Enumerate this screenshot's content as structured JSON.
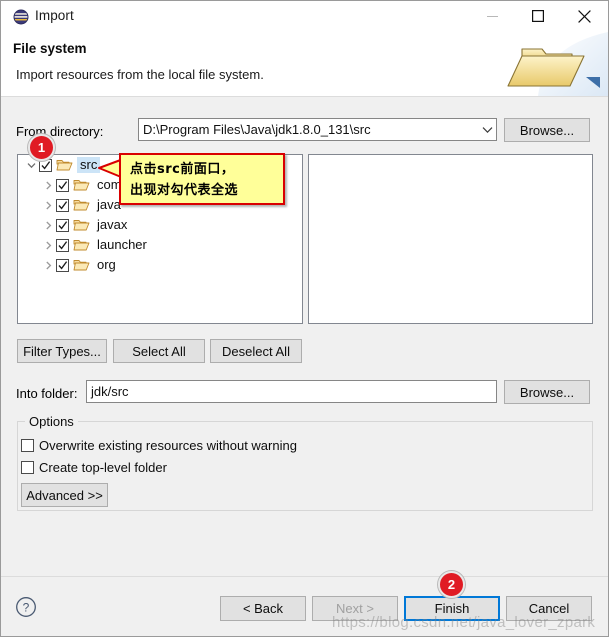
{
  "window": {
    "title": "Import",
    "app_icon": "eclipse-icon",
    "controls": {
      "minimize": "minimize-icon",
      "maximize": "maximize-icon",
      "close": "close-icon"
    }
  },
  "header": {
    "title": "File system",
    "description": "Import resources from the local file system.",
    "art_icon": "open-folder-illustration"
  },
  "from_directory": {
    "label": "From directory:",
    "value": "D:\\Program Files\\Java\\jdk1.8.0_131\\src",
    "placeholder": "",
    "browse_label": "Browse..."
  },
  "tree": {
    "items": [
      {
        "label": "src",
        "level": 0,
        "expanded": true,
        "checked": true,
        "selected": true,
        "twisty": "chevron-down-icon"
      },
      {
        "label": "com",
        "level": 1,
        "expanded": false,
        "checked": true,
        "selected": false,
        "twisty": "chevron-right-icon"
      },
      {
        "label": "java",
        "level": 1,
        "expanded": false,
        "checked": true,
        "selected": false,
        "twisty": "chevron-right-icon"
      },
      {
        "label": "javax",
        "level": 1,
        "expanded": false,
        "checked": true,
        "selected": false,
        "twisty": "chevron-right-icon"
      },
      {
        "label": "launcher",
        "level": 1,
        "expanded": false,
        "checked": true,
        "selected": false,
        "twisty": "chevron-right-icon"
      },
      {
        "label": "org",
        "level": 1,
        "expanded": false,
        "checked": true,
        "selected": false,
        "twisty": "chevron-right-icon"
      }
    ]
  },
  "file_pane": {
    "items": []
  },
  "selection_buttons": {
    "filter_types": "Filter Types...",
    "select_all": "Select All",
    "deselect_all": "Deselect All"
  },
  "into_folder": {
    "label": "Into folder:",
    "value": "jdk/src",
    "placeholder": "",
    "browse_label": "Browse..."
  },
  "options": {
    "legend": "Options",
    "checkboxes": [
      {
        "label": "Overwrite existing resources without warning",
        "checked": false
      },
      {
        "label": "Create top-level folder",
        "checked": false
      }
    ],
    "advanced_label": "Advanced  >>"
  },
  "footer": {
    "help_icon": "help-question-icon",
    "back": "< Back",
    "next": "Next >",
    "finish": "Finish",
    "cancel": "Cancel",
    "next_disabled": true,
    "finish_focused": true
  },
  "annotations": {
    "badge_one": "1",
    "badge_two": "2",
    "callout_line1": "点击src前面口，",
    "callout_line2": "出现对勾代表全选"
  },
  "watermark": "https://blog.csdn.net/java_lover_zpark",
  "colors": {
    "accent": "#0078d7",
    "annotation_red": "#e01b24",
    "callout_bg": "#ffff99",
    "callout_border": "#d90000",
    "dialog_bg": "#f0f0f0",
    "selection_blue": "#cce4f7"
  }
}
